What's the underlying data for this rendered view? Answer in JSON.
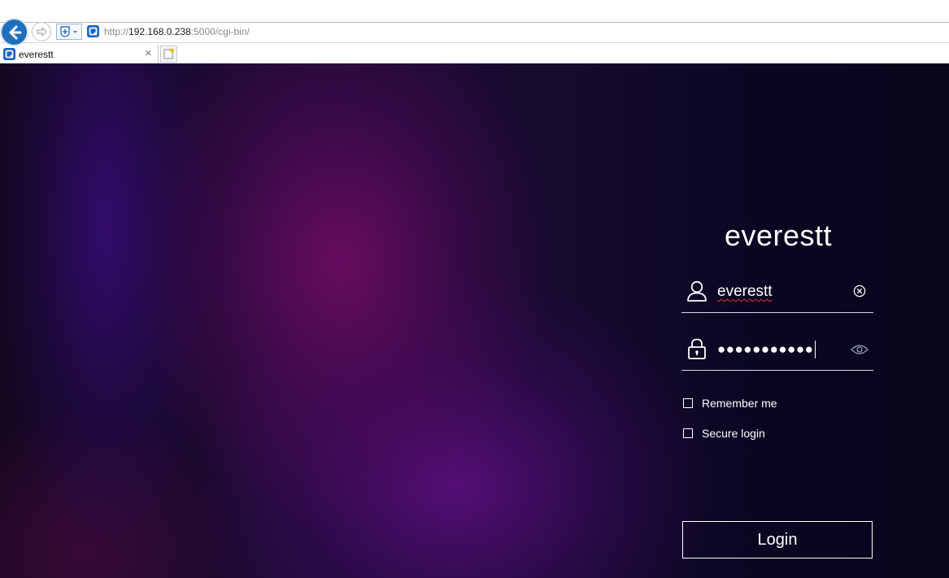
{
  "browser": {
    "url_prefix": "http://",
    "url_host": "192.168.0.238",
    "url_suffix": ":5000/cgi-bin/",
    "tab_title": "everestt",
    "tab_close": "×"
  },
  "login": {
    "device_name": "everestt",
    "username_value": "everestt",
    "password_mask": "●●●●●●●●●●●",
    "remember_label": "Remember me",
    "remember_checked": false,
    "secure_label": "Secure login",
    "secure_checked": false,
    "login_label": "Login"
  },
  "colors": {
    "accent_browser_blue": "#1f6fbf",
    "text_white": "#ffffff",
    "spellcheck_red": "#e0322f"
  },
  "icons": {
    "back": "arrow-left-icon",
    "forward": "arrow-right-icon",
    "compat": "shield-plus-icon",
    "favicon": "qnap-q-icon",
    "new_tab": "new-tab-icon",
    "user": "user-icon",
    "lock": "lock-icon",
    "clear": "clear-circle-icon",
    "eye": "eye-icon"
  }
}
